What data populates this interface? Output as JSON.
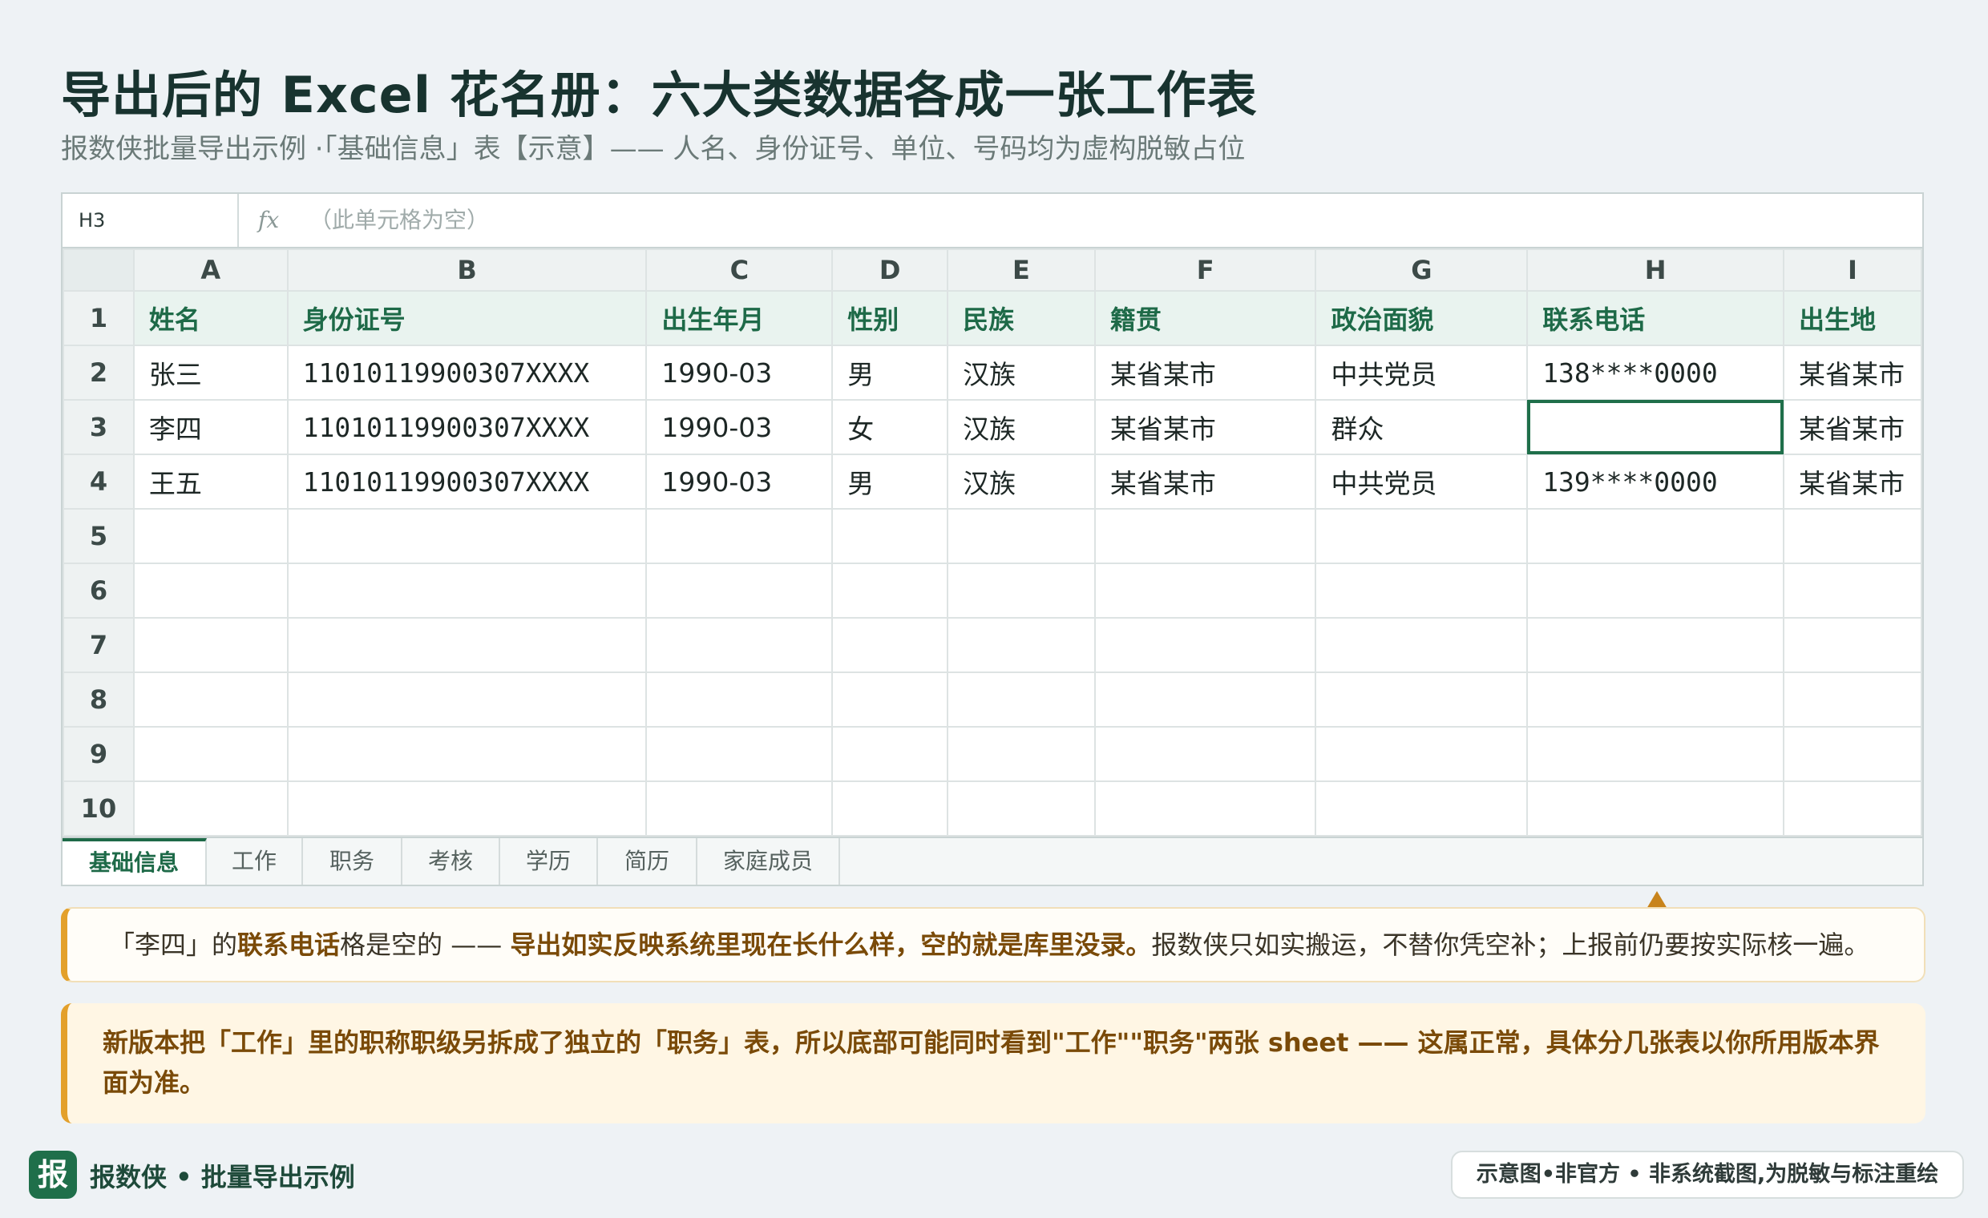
{
  "title": "导出后的 Excel 花名册：六大类数据各成一张工作表",
  "subtitle": "报数侠批量导出示例 ·「基础信息」表【示意】—— 人名、身份证号、单位、号码均为虚构脱敏占位",
  "formula_bar": {
    "name_box": "H3",
    "fx_label": "fx",
    "content": "（此单元格为空）"
  },
  "columns": [
    "A",
    "B",
    "C",
    "D",
    "E",
    "F",
    "G",
    "H",
    "I"
  ],
  "row_numbers": [
    "1",
    "2",
    "3",
    "4",
    "5",
    "6",
    "7",
    "8",
    "9",
    "10"
  ],
  "header_row": [
    "姓名",
    "身份证号",
    "出生年月",
    "性别",
    "民族",
    "籍贯",
    "政治面貌",
    "联系电话",
    "出生地"
  ],
  "data_rows": [
    [
      "张三",
      "11010119900307XXXX",
      "1990-03",
      "男",
      "汉族",
      "某省某市",
      "中共党员",
      "138****0000",
      "某省某市"
    ],
    [
      "李四",
      "11010119900307XXXX",
      "1990-03",
      "女",
      "汉族",
      "某省某市",
      "群众",
      "",
      "某省某市"
    ],
    [
      "王五",
      "11010119900307XXXX",
      "1990-03",
      "男",
      "汉族",
      "某省某市",
      "中共党员",
      "139****0000",
      "某省某市"
    ]
  ],
  "sheet_tabs": [
    {
      "label": "基础信息",
      "active": true
    },
    {
      "label": "工作",
      "active": false
    },
    {
      "label": "职务",
      "active": false
    },
    {
      "label": "考核",
      "active": false
    },
    {
      "label": "学历",
      "active": false
    },
    {
      "label": "简历",
      "active": false
    },
    {
      "label": "家庭成员",
      "active": false
    }
  ],
  "note1": {
    "part1": "「李四」的",
    "part2": "联系电话",
    "part3": "格是空的 —— ",
    "part4": "导出如实反映系统里现在长什么样，空的就是库里没录。",
    "part5": "报数侠只如实搬运，不替你凭空补；上报前仍要按实际核一遍。"
  },
  "note2": "新版本把「工作」里的职称职级另拆成了独立的「职务」表，所以底部可能同时看到\"工作\"\"职务\"两张 sheet —— 这属正常，具体分几张表以你所用版本界面为准。",
  "footer": {
    "logo_char": "报",
    "brand": "报数侠 • 批量导出示例",
    "badge": "示意图•非官方 • 非系统截图,为脱敏与标注重绘"
  },
  "colors": {
    "accent_green": "#1e6a48",
    "accent_orange": "#e3a02b",
    "header_fill": "#e9f3ef"
  }
}
